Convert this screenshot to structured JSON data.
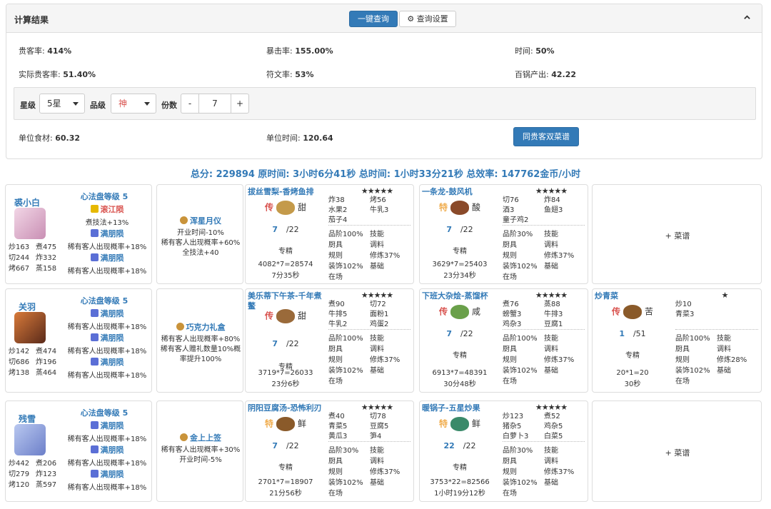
{
  "header": {
    "title": "计算结果",
    "query_btn": "一键查询",
    "settings_btn": "查询设置"
  },
  "stats": {
    "guest_rate_label": "贵客率:",
    "guest_rate": "414%",
    "crit_rate_label": "暴击率:",
    "crit_rate": "155.00%",
    "time_label": "时间:",
    "time": "50%",
    "actual_guest_label": "实际贵客率:",
    "actual_guest": "51.40%",
    "rune_label": "符文率:",
    "rune": "53%",
    "pot_label": "百锅产出:",
    "pot": "42.22",
    "unit_food_label": "单位食材:",
    "unit_food": "60.32",
    "unit_time_label": "单位时间:",
    "unit_time": "120.64"
  },
  "options": {
    "star_label": "星级",
    "star_value": "5星",
    "grade_label": "品级",
    "grade_value": "神",
    "portion_label": "份数",
    "minus": "-",
    "portion_value": "7",
    "plus": "+"
  },
  "guest_button": "同贵客双菜谱",
  "summary": "总分: 229894 原时间: 3小时6分41秒 总时间: 1小时33分21秒 总效率: 147762金币/小时",
  "rows": [
    {
      "chef": {
        "name": "裘小白",
        "stats": [
          "炒163",
          "煮475",
          "切244",
          "炸332",
          "烤667",
          "蒸158"
        ],
        "heart": "心法盘等级 5",
        "skills": [
          {
            "name": "滚江陨",
            "desc": "煮技法+13%",
            "color": "red"
          },
          {
            "name": "满朋陨",
            "desc": "稀有客人出现概率+18%",
            "color": "blue"
          },
          {
            "name": "满朋陨",
            "desc": "稀有客人出现概率+18%",
            "color": "blue"
          }
        ]
      },
      "equip": {
        "name": "浑星月仪",
        "lines": [
          "开业时间-10%",
          "稀有客人出现概率+60%",
          "全技法+40"
        ]
      },
      "dishes": [
        {
          "name": "拔丝雪梨-香烤鱼排",
          "stars": "★★★★★",
          "tier": "传",
          "tier_color": "red",
          "taste": "甜",
          "qty": "7",
          "max": "/22",
          "label": "专精",
          "calc": "4082*7=28574",
          "time": "7分35秒",
          "skills": [
            "炸38",
            "烤56",
            "水果2",
            "牛乳3",
            "茄子4",
            ""
          ],
          "attrs": [
            "品阶100%",
            "技能",
            "厨具",
            "调料",
            "规则",
            "修炼37%",
            "装饰102%",
            "基础",
            "在场",
            ""
          ]
        },
        {
          "name": "一条龙-鼓风机",
          "stars": "★★★★★",
          "tier": "特",
          "tier_color": "orange",
          "taste": "酸",
          "qty": "7",
          "max": "/22",
          "label": "专精",
          "calc": "3629*7=25403",
          "time": "23分34秒",
          "skills": [
            "切76",
            "炸84",
            "酒3",
            "鱼翅3",
            "童子鸡2",
            ""
          ],
          "attrs": [
            "品阶30%",
            "技能",
            "厨具",
            "调料",
            "规则",
            "修炼37%",
            "装饰102%",
            "基础",
            "在场",
            ""
          ]
        },
        {
          "empty": "+ 菜谱"
        }
      ]
    },
    {
      "chef": {
        "name": "关羽",
        "stats": [
          "炒142",
          "煮474",
          "切686",
          "炸196",
          "烤138",
          "蒸464"
        ],
        "heart": "心法盘等级 5",
        "skills": [
          {
            "name": "满朋陨",
            "desc": "稀有客人出现概率+18%",
            "color": "blue"
          },
          {
            "name": "满朋陨",
            "desc": "稀有客人出现概率+18%",
            "color": "blue"
          },
          {
            "name": "满朋陨",
            "desc": "稀有客人出现概率+18%",
            "color": "blue"
          }
        ]
      },
      "equip": {
        "name": "巧克力礼盒",
        "lines": [
          "稀有客人出现概率+80%",
          "稀有客人赠礼数量10%概率提升100%"
        ]
      },
      "dishes": [
        {
          "name": "美乐蒂下午茶-千年煮鳖",
          "stars": "★★★★★",
          "tier": "传",
          "tier_color": "red",
          "taste": "甜",
          "qty": "7",
          "max": "/22",
          "label": "专精",
          "calc": "3719*7=26033",
          "time": "23分6秒",
          "skills": [
            "煮90",
            "切72",
            "牛排5",
            "面粉1",
            "牛乳2",
            "鸡蛋2"
          ],
          "attrs": [
            "品阶100%",
            "技能",
            "厨具",
            "调料",
            "规则",
            "修炼37%",
            "装饰102%",
            "基础",
            "在场",
            ""
          ]
        },
        {
          "name": "下班大杂烩-蒸馏杯",
          "stars": "★★★★★",
          "tier": "传",
          "tier_color": "red",
          "taste": "咸",
          "qty": "7",
          "max": "/22",
          "label": "专精",
          "calc": "6913*7=48391",
          "time": "30分48秒",
          "skills": [
            "煮76",
            "蒸88",
            "螃蟹3",
            "牛排3",
            "鸡杂3",
            "豆腐1"
          ],
          "attrs": [
            "品阶100%",
            "技能",
            "厨具",
            "调料",
            "规则",
            "修炼37%",
            "装饰102%",
            "基础",
            "在场",
            ""
          ]
        },
        {
          "name": "炒青菜",
          "stars": "★",
          "tier": "传",
          "tier_color": "red",
          "taste": "苦",
          "qty": "1",
          "max": "/51",
          "label": "专精",
          "calc": "20*1=20",
          "time": "30秒",
          "skills": [
            "炒10",
            "",
            "青菜3",
            "",
            "",
            ""
          ],
          "attrs": [
            "品阶100%",
            "技能",
            "厨具",
            "调料",
            "规则",
            "修炼28%",
            "装饰102%",
            "基础",
            "在场",
            ""
          ]
        }
      ]
    },
    {
      "chef": {
        "name": "残雪",
        "stats": [
          "炒442",
          "煮206",
          "切279",
          "炸123",
          "烤120",
          "蒸597"
        ],
        "heart": "心法盘等级 5",
        "skills": [
          {
            "name": "满朋陨",
            "desc": "稀有客人出现概率+18%",
            "color": "blue"
          },
          {
            "name": "满朋陨",
            "desc": "稀有客人出现概率+18%",
            "color": "blue"
          },
          {
            "name": "满朋陨",
            "desc": "稀有客人出现概率+18%",
            "color": "blue"
          }
        ]
      },
      "equip": {
        "name": "金上上签",
        "lines": [
          "稀有客人出现概率+30%",
          "开业时间-5%"
        ]
      },
      "dishes": [
        {
          "name": "阴阳豆腐汤-恐怖利刃",
          "stars": "★★★★★",
          "tier": "特",
          "tier_color": "orange",
          "taste": "鲜",
          "qty": "7",
          "max": "/22",
          "label": "专精",
          "calc": "2701*7=18907",
          "time": "21分56秒",
          "skills": [
            "煮40",
            "切78",
            "青菜5",
            "豆腐5",
            "黄瓜3",
            "笋4"
          ],
          "attrs": [
            "品阶30%",
            "技能",
            "厨具",
            "调料",
            "规则",
            "修炼37%",
            "装饰102%",
            "基础",
            "在场",
            ""
          ]
        },
        {
          "name": "暖锅子-五星炒果",
          "stars": "★★★★★",
          "tier": "特",
          "tier_color": "orange",
          "taste": "鲜",
          "qty": "22",
          "max": "/22",
          "label": "专精",
          "calc": "3753*22=82566",
          "time": "1小时19分12秒",
          "skills": [
            "炒123",
            "煮52",
            "猪杂5",
            "鸡杂5",
            "白萝卜3",
            "白菜5"
          ],
          "attrs": [
            "品阶30%",
            "技能",
            "厨具",
            "调料",
            "规则",
            "修炼37%",
            "装饰102%",
            "基础",
            "在场",
            ""
          ]
        },
        {
          "empty": "+ 菜谱"
        }
      ]
    }
  ],
  "colors": {
    "primary": "#337ab7",
    "red": "#d9534f",
    "orange": "#f0ad4e"
  }
}
